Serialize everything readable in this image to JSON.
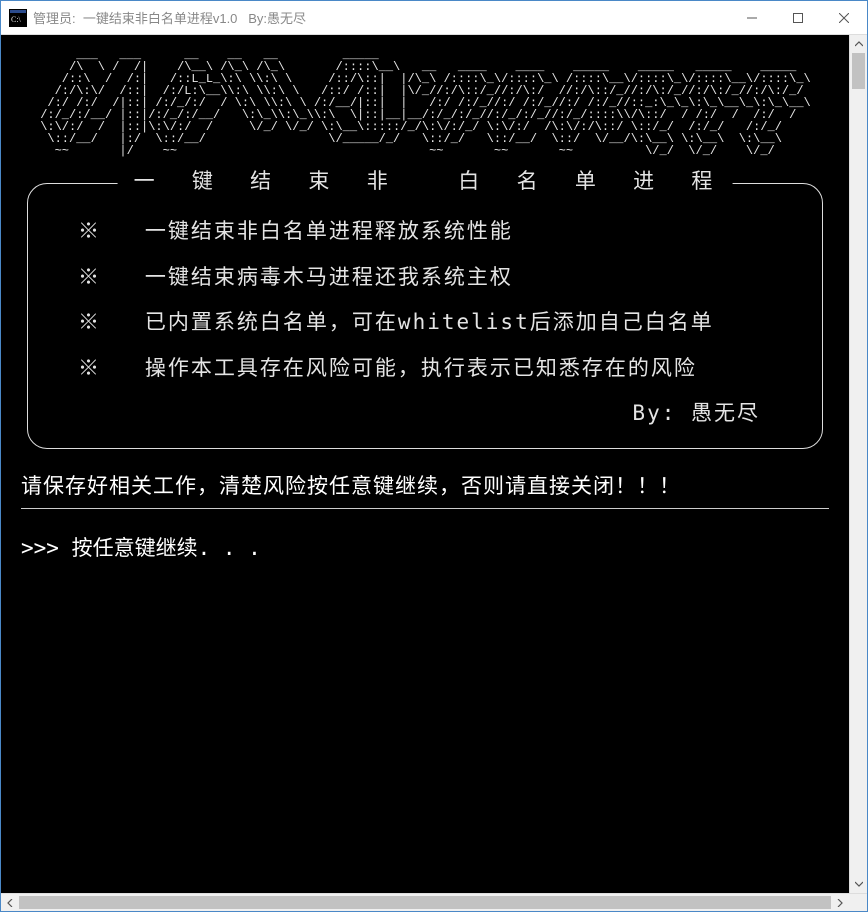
{
  "window": {
    "title": "管理员:  一键结束非白名单进程v1.0   By:愚无尽"
  },
  "ascii_art": "      ___   ___      __    __   __         _____                                                            \n     /\\  \\ /  /|    /\\__\\ /\\_\\ /\\_\\       /::::\\__\\   __   ____    ____    _____    _____   _____    _____  \n    /::\\  /  /:|   /::L_L_\\:\\ \\\\:\\ \\     /::/\\::|  |/\\_\\ /::::\\_\\/::::\\_\\ /::::\\__\\/::::\\_\\/::::\\__\\/::::\\_\\\n   /:/\\:\\/  /::|  /:/L:\\__\\\\:\\ \\\\:\\ \\   /::/ /::|  |\\/_//:/\\::/_//:/\\:/  //:/\\::/_//:/\\:/_//:/\\:/_//:/\\:/_/\n  /:/ /:/  /|::| /:/_/:/  / \\:\\ \\\\:\\ \\ /:/__/|::|  |   /:/ /:/_//:/ /:/_//:/ /:/_//::_:\\_\\_\\:\\_\\__\\_\\:\\_\\__\\\n /:/_/:/__/ |::|/:/_/:/__/   \\:\\_\\\\:\\_\\\\:\\  \\|::|__|__/:/_/:/_//:/_/:/_//:/_/::::\\\\/\\::/  / /:/  /  /:/  / \n \\:\\/:/  /  |::|\\:\\/:/  /     \\/_/ \\/_/ \\:\\__\\:::::/_/\\:\\/:/_/ \\:\\/:/  /\\:\\/:/\\::/ \\::/_/  /:/_/   /:/_/  \n  \\::/__/   |:/  \\::/__/                 \\/_____/_/   \\::/_/   \\::/__/  \\::/  \\/__/\\:\\__\\ \\:\\__\\  \\:\\__\\ \n   ~~       |/    ~~                                   ~~       ~~       ~~          \\/_/  \\/_/    \\/_/  ",
  "box": {
    "title": "一  键  结  束  非    白  名  单  进  程",
    "bullets": [
      "※   一键结束非白名单进程释放系统性能",
      "※   一键结束病毒木马进程还我系统主权",
      "※   已内置系统白名单，可在whitelist后添加自己白名单",
      "※   操作本工具存在风险可能，执行表示已知悉存在的风险"
    ],
    "byline": "By:  愚无尽"
  },
  "warning": "请保存好相关工作，清楚风险按任意键继续，否则请直接关闭！！！",
  "prompt": ">>> 按任意键继续. . ."
}
